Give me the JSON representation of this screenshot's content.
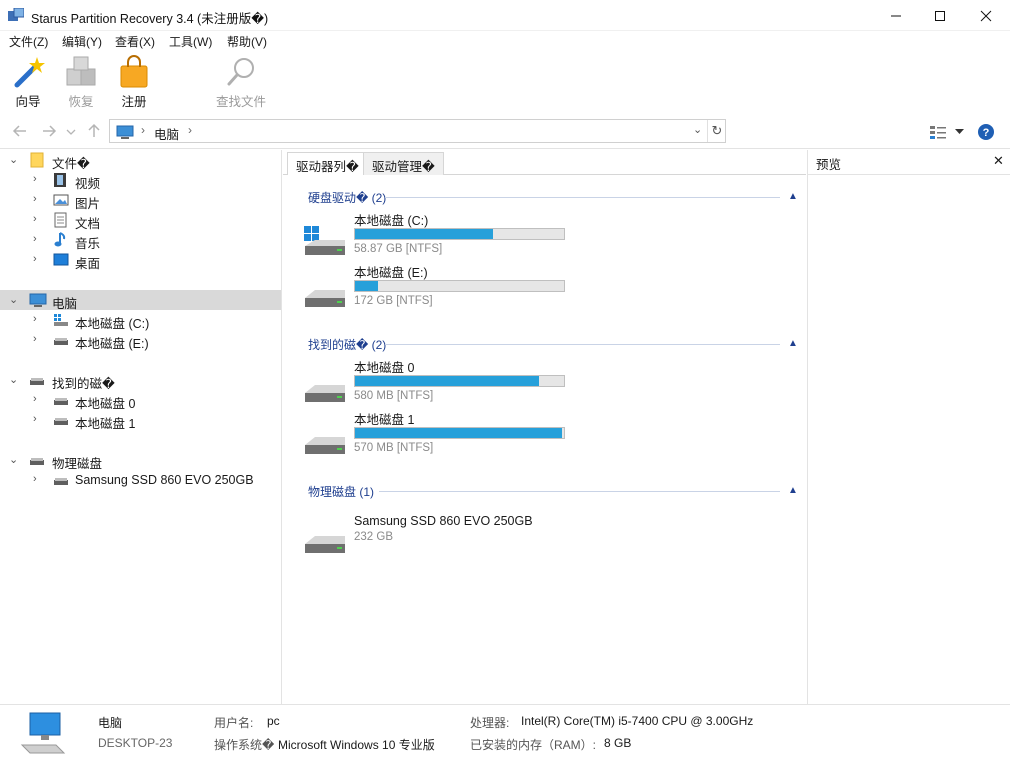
{
  "window": {
    "title": "Starus Partition Recovery 3.4 (未注册版�)",
    "minimize_glyph": "—",
    "maximize_glyph": "☐",
    "close_glyph": "✕"
  },
  "menu": [
    "文件(Z)",
    "编辑(Y)",
    "查看(X)",
    "工具(W)",
    "帮助(V)"
  ],
  "toolbar": {
    "wizard": "向导",
    "recover": "恢复",
    "register": "注册",
    "find_files": "查找文件"
  },
  "address": {
    "location": "电脑",
    "separator": "›",
    "refresh_glyph": "↻",
    "dropdown_glyph": "⌄"
  },
  "tree": {
    "files": {
      "label": "文件�",
      "children": [
        "视频",
        "图片",
        "文档",
        "音乐",
        "桌面"
      ]
    },
    "computer": {
      "label": "电脑",
      "children": [
        "本地磁盘 (C:)",
        "本地磁盘 (E:)"
      ]
    },
    "found": {
      "label": "找到的磁�",
      "children": [
        "本地磁盘 0",
        "本地磁盘 1"
      ]
    },
    "physical": {
      "label": "物理磁盘",
      "children": [
        "Samsung SSD 860 EVO 250GB"
      ]
    }
  },
  "tabs": [
    "驱动器列�",
    "驱动管理�"
  ],
  "groups": [
    {
      "title": "硬盘驱动� (2)",
      "drives": [
        {
          "name": "本地磁盘 (C:)",
          "info": "58.87 GB [NTFS]",
          "fill": 0.66,
          "icon": "windows-drive-icon"
        },
        {
          "name": "本地磁盘 (E:)",
          "info": "172 GB [NTFS]",
          "fill": 0.11,
          "icon": "hard-drive-icon"
        }
      ]
    },
    {
      "title": "找到的磁� (2)",
      "drives": [
        {
          "name": "本地磁盘 0",
          "info": "580 MB [NTFS]",
          "fill": 0.88,
          "icon": "hard-drive-icon"
        },
        {
          "name": "本地磁盘 1",
          "info": "570 MB [NTFS]",
          "fill": 0.99,
          "icon": "hard-drive-icon"
        }
      ]
    },
    {
      "title": "物理磁盘 (1)",
      "drives": [
        {
          "name": "Samsung SSD 860 EVO 250GB",
          "info": "232 GB",
          "icon": "hard-drive-icon"
        }
      ]
    }
  ],
  "preview": {
    "title": "预览",
    "close_glyph": "✕"
  },
  "status": {
    "name": "电脑",
    "host": "DESKTOP-23",
    "user_label": "用户名:",
    "user": "pc",
    "os_label": "操作系统�",
    "os": "Microsoft Windows 10 专业版",
    "cpu_label": "处理器:",
    "cpu": "Intel(R) Core(TM) i5-7400 CPU @ 3.00GHz",
    "ram_label": "已安装的内存（RAM）:",
    "ram": "8 GB"
  },
  "colors": {
    "accent": "#26a0da",
    "group_text": "#1f3f8f",
    "selected_row": "#d9d9d9"
  }
}
